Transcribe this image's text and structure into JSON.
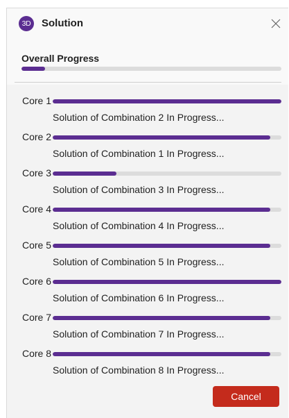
{
  "window": {
    "title": "Solution",
    "app_icon_text": "3D",
    "accent_color": "#5b2d91"
  },
  "overall": {
    "label": "Overall Progress",
    "progress": 0.09
  },
  "cores": [
    {
      "label": "Core 1",
      "progress": 1.0,
      "status": "Solution of Combination 2 In Progress..."
    },
    {
      "label": "Core 2",
      "progress": 0.95,
      "status": "Solution of Combination 1 In Progress..."
    },
    {
      "label": "Core 3",
      "progress": 0.28,
      "status": "Solution of Combination 3 In Progress..."
    },
    {
      "label": "Core 4",
      "progress": 0.95,
      "status": "Solution of Combination 4 In Progress..."
    },
    {
      "label": "Core 5",
      "progress": 0.95,
      "status": "Solution of Combination 5 In Progress..."
    },
    {
      "label": "Core 6",
      "progress": 1.0,
      "status": "Solution of Combination 6 In Progress..."
    },
    {
      "label": "Core 7",
      "progress": 0.95,
      "status": "Solution of Combination 7 In Progress..."
    },
    {
      "label": "Core 8",
      "progress": 0.95,
      "status": "Solution of Combination 8 In Progress..."
    }
  ],
  "footer": {
    "cancel_label": "Cancel",
    "cancel_color": "#c42b1c"
  },
  "icons": {
    "app": "app-logo-icon",
    "close": "close-icon"
  }
}
